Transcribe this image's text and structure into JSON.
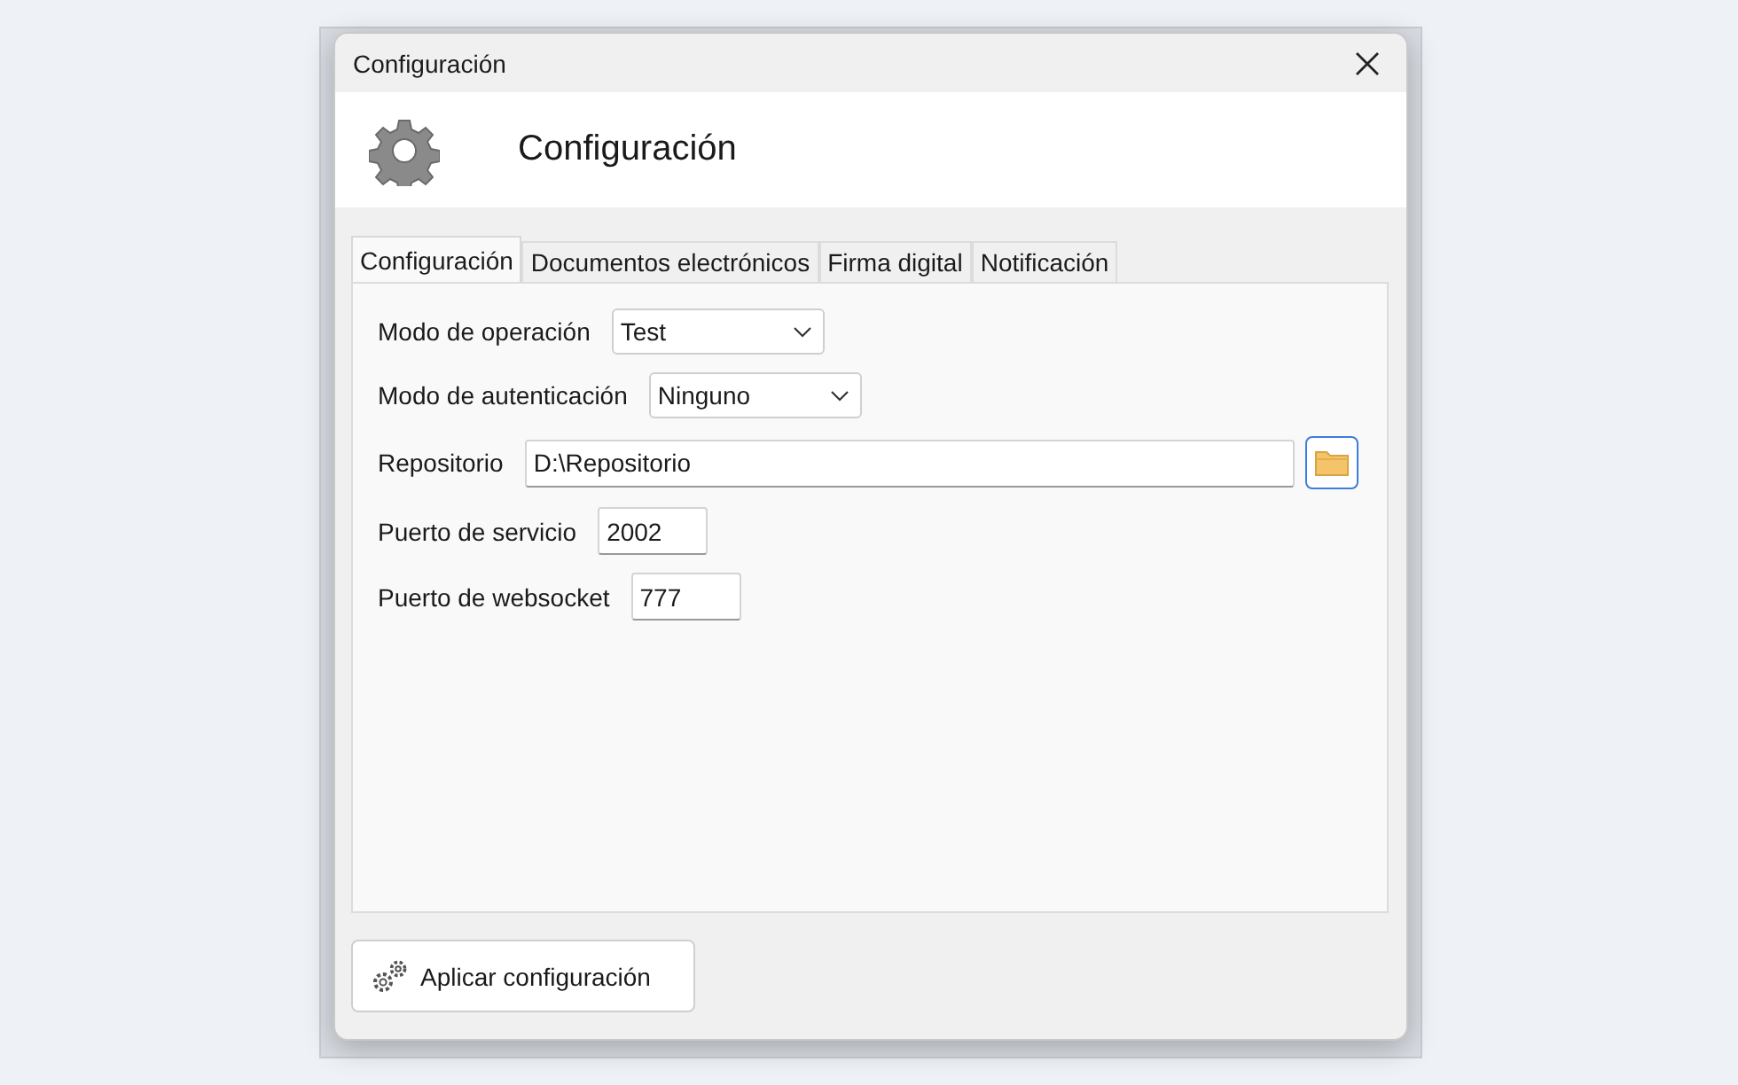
{
  "window": {
    "title": "Configuración"
  },
  "header": {
    "title": "Configuración"
  },
  "tabs": [
    {
      "label": "Configuración",
      "selected": true
    },
    {
      "label": "Documentos electrónicos",
      "selected": false
    },
    {
      "label": "Firma digital",
      "selected": false
    },
    {
      "label": "Notificación",
      "selected": false
    }
  ],
  "fields": [
    {
      "kind": "select",
      "label": "Modo de operación",
      "value": "Test"
    },
    {
      "kind": "select",
      "label": "Modo de autenticación",
      "value": "Ninguno"
    },
    {
      "kind": "path",
      "label": "Repositorio",
      "value": "D:\\Repositorio"
    },
    {
      "kind": "text",
      "label": "Puerto de servicio",
      "value": "2002"
    },
    {
      "kind": "text",
      "label": "Puerto de websocket",
      "value": "777"
    }
  ],
  "apply_button": {
    "label": "Aplicar configuración"
  }
}
